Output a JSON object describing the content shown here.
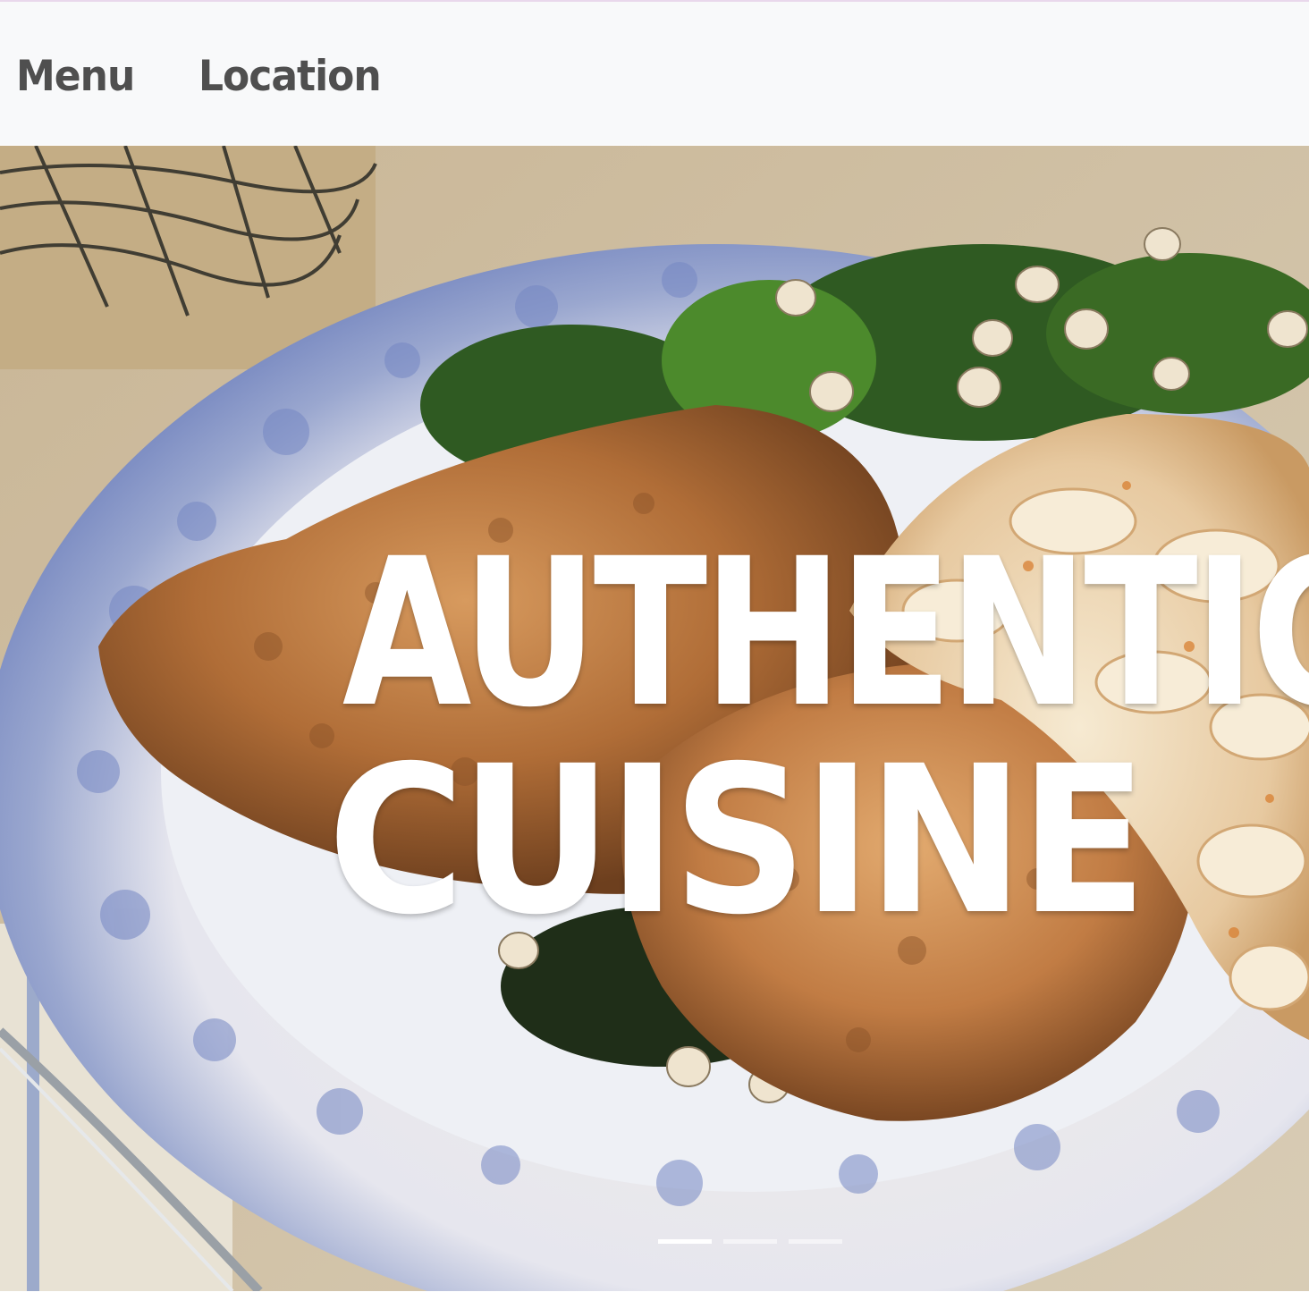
{
  "navbar": {
    "links": [
      {
        "label": "Menu"
      },
      {
        "label": "Location"
      }
    ]
  },
  "hero": {
    "title_line1": "AUTHENTIC",
    "title_line2": "CUISINE",
    "image_icon": "plated-fried-chicken-photo",
    "carousel": {
      "slide_count": 3,
      "active_index": 0
    }
  },
  "colors": {
    "nav_background": "#f8f9fa",
    "nav_text": "#4f4f4f",
    "hero_text": "#ffffff"
  }
}
